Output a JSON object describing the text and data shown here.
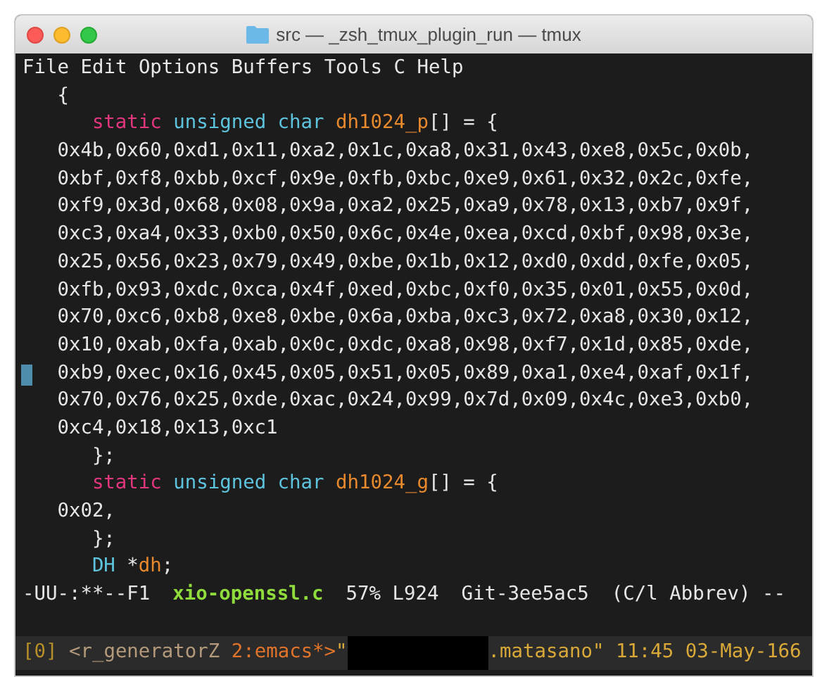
{
  "window": {
    "title": "src — _zsh_tmux_plugin_run — tmux"
  },
  "menu": [
    "File",
    "Edit",
    "Options",
    "Buffers",
    "Tools",
    "C",
    "Help"
  ],
  "code_lines": [
    {
      "cursor": false,
      "segments": [
        {
          "kind": "plain",
          "text": "   {"
        }
      ]
    },
    {
      "cursor": false,
      "segments": [
        {
          "kind": "keyword",
          "text": "      static"
        },
        {
          "kind": "type",
          "text": " unsigned char"
        },
        {
          "kind": "name",
          "text": " dh1024_p"
        },
        {
          "kind": "plain",
          "text": "[] = {"
        }
      ]
    },
    {
      "cursor": false,
      "segments": [
        {
          "kind": "plain",
          "text": "   0x4b,0x60,0xd1,0x11,0xa2,0x1c,0xa8,0x31,0x43,0xe8,0x5c,0x0b,"
        }
      ]
    },
    {
      "cursor": false,
      "segments": [
        {
          "kind": "plain",
          "text": "   0xbf,0xf8,0xbb,0xcf,0x9e,0xfb,0xbc,0xe9,0x61,0x32,0x2c,0xfe,"
        }
      ]
    },
    {
      "cursor": false,
      "segments": [
        {
          "kind": "plain",
          "text": "   0xf9,0x3d,0x68,0x08,0x9a,0xa2,0x25,0xa9,0x78,0x13,0xb7,0x9f,"
        }
      ]
    },
    {
      "cursor": false,
      "segments": [
        {
          "kind": "plain",
          "text": "   0xc3,0xa4,0x33,0xb0,0x50,0x6c,0x4e,0xea,0xcd,0xbf,0x98,0x3e,"
        }
      ]
    },
    {
      "cursor": false,
      "segments": [
        {
          "kind": "plain",
          "text": "   0x25,0x56,0x23,0x79,0x49,0xbe,0x1b,0x12,0xd0,0xdd,0xfe,0x05,"
        }
      ]
    },
    {
      "cursor": false,
      "segments": [
        {
          "kind": "plain",
          "text": "   0xfb,0x93,0xdc,0xca,0x4f,0xed,0xbc,0xf0,0x35,0x01,0x55,0x0d,"
        }
      ]
    },
    {
      "cursor": false,
      "segments": [
        {
          "kind": "plain",
          "text": "   0x70,0xc6,0xb8,0xe8,0xbe,0x6a,0xba,0xc3,0x72,0xa8,0x30,0x12,"
        }
      ]
    },
    {
      "cursor": false,
      "segments": [
        {
          "kind": "plain",
          "text": "   0x10,0xab,0xfa,0xab,0x0c,0xdc,0xa8,0x98,0xf7,0x1d,0x85,0xde,"
        }
      ]
    },
    {
      "cursor": true,
      "segments": [
        {
          "kind": "plain",
          "text": "   0xb9,0xec,0x16,0x45,0x05,0x51,0x05,0x89,0xa1,0xe4,0xaf,0x1f,"
        }
      ]
    },
    {
      "cursor": false,
      "segments": [
        {
          "kind": "plain",
          "text": "   0x70,0x76,0x25,0xde,0xac,0x24,0x99,0x7d,0x09,0x4c,0xe3,0xb0,"
        }
      ]
    },
    {
      "cursor": false,
      "segments": [
        {
          "kind": "plain",
          "text": "   0xc4,0x18,0x13,0xc1"
        }
      ]
    },
    {
      "cursor": false,
      "segments": [
        {
          "kind": "plain",
          "text": "      };"
        }
      ]
    },
    {
      "cursor": false,
      "segments": [
        {
          "kind": "keyword",
          "text": "      static"
        },
        {
          "kind": "type",
          "text": " unsigned char"
        },
        {
          "kind": "name",
          "text": " dh1024_g"
        },
        {
          "kind": "plain",
          "text": "[] = {"
        }
      ]
    },
    {
      "cursor": false,
      "segments": [
        {
          "kind": "plain",
          "text": "   0x02,"
        }
      ]
    },
    {
      "cursor": false,
      "segments": [
        {
          "kind": "plain",
          "text": "      };"
        }
      ]
    },
    {
      "cursor": false,
      "segments": [
        {
          "kind": "type",
          "text": "      DH"
        },
        {
          "kind": "plain",
          "text": " *"
        },
        {
          "kind": "name",
          "text": "dh"
        },
        {
          "kind": "plain",
          "text": ";"
        }
      ]
    }
  ],
  "mode_line": [
    {
      "kind": "plain",
      "text": "-UU-:**--F1"
    },
    {
      "kind": "buffer",
      "text": "xio-openssl.c"
    },
    {
      "kind": "plain",
      "text": "57% L924"
    },
    {
      "kind": "plain",
      "text": "Git-3ee5ac5"
    },
    {
      "kind": "plain",
      "text": "(C/l Abbrev) --"
    }
  ],
  "tmux_status": [
    {
      "kind": "index",
      "text": "[0]"
    },
    {
      "kind": "session",
      "text": "<r_generatorZ"
    },
    {
      "kind": "window",
      "text": "2:emacs*>"
    },
    {
      "kind": "host",
      "text": "\""
    },
    {
      "kind": "redacted"
    },
    {
      "kind": "host",
      "text": ".matasano\" 11:45 03-May-166"
    }
  ]
}
